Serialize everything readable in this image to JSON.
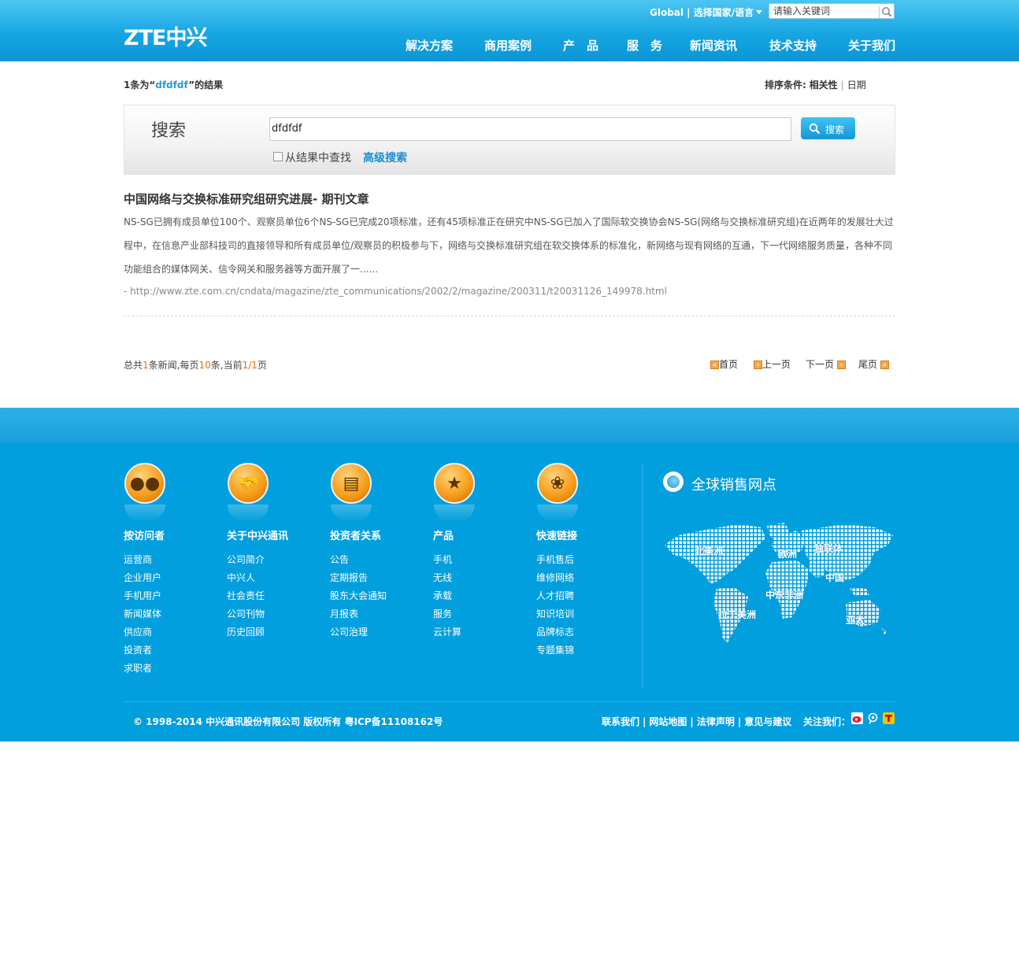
{
  "header": {
    "logo": "ZTE中兴",
    "global_label": "Global | 选择国家/语言",
    "search_placeholder": "请输入关键词",
    "nav": [
      "解决方案",
      "商用案例",
      "产　品",
      "服　务",
      "新闻资讯",
      "技术支持",
      "关于我们"
    ]
  },
  "results_header": {
    "count_prefix": "1条为“",
    "keyword": "dfdfdf",
    "count_suffix": "”的结果",
    "sort_label": "排序条件:",
    "sort_relevance": "相关性",
    "sort_date": "日期"
  },
  "search_box": {
    "title": "搜索",
    "query": "dfdfdf",
    "button": "搜索",
    "within_results": "从结果中查找",
    "advanced": "高级搜索"
  },
  "result": {
    "title": "中国网络与交换标准研究组研究进展- 期刊文章",
    "description": "NS-SG已拥有成员单位100个、观察员单位6个NS-SG已完成20项标准，还有45项标准正在研究中NS-SG已加入了国际软交换协会NS-SG(网络与交换标准研究组)在近两年的发展壮大过程中，在信息产业部科技司的直接领导和所有成员单位/观察员的积极参与下，网络与交换标准研究组在软交换体系的标准化，新网络与现有网络的互通，下一代网络服务质量，各种不同功能组合的媒体网关、信令网关和服务器等方面开展了一......",
    "url": "- http://www.zte.com.cn/cndata/magazine/zte_communications/2002/2/magazine/200311/t20031126_149978.html"
  },
  "pager": {
    "t1": "总共",
    "total": "1",
    "t2": "条新闻,每页",
    "per_page": "10",
    "t3": "条,当前",
    "current": "1/1",
    "t4": "页",
    "first": "首页",
    "prev": "上一页",
    "next": "下一页",
    "last": "尾页"
  },
  "footer": {
    "columns": [
      {
        "title": "按访问者",
        "links": [
          "运营商",
          "企业用户",
          "手机用户",
          "新闻媒体",
          "供应商",
          "投资者",
          "求职者"
        ]
      },
      {
        "title": "关于中兴通讯",
        "links": [
          "公司简介",
          "中兴人",
          "社会责任",
          "公司刊物",
          "历史回顾"
        ]
      },
      {
        "title": "投资者关系",
        "links": [
          "公告",
          "定期报告",
          "股东大会通知",
          "月报表",
          "公司治理"
        ]
      },
      {
        "title": "产品",
        "links": [
          "手机",
          "无线",
          "承载",
          "服务",
          "云计算"
        ]
      },
      {
        "title": "快速链接",
        "links": [
          "手机售后",
          "维修网络",
          "人才招聘",
          "知识培训",
          "品牌标志",
          "专题集锦"
        ]
      }
    ],
    "global_title": "全球销售网点",
    "regions": [
      "北美洲",
      "欧洲",
      "独联体",
      "中国",
      "中东非洲",
      "拉丁美洲",
      "亚太"
    ],
    "copyright": "© 1998-2014 中兴通讯股份有限公司 版权所有   粤ICP备11108162号",
    "links": [
      "联系我们",
      "网站地图",
      "法律声明",
      "意见与建议"
    ],
    "follow": "关注我们："
  },
  "colors": {
    "header_blue": "#17a6e2",
    "footer_blue": "#019fde",
    "link_blue": "#1a8fd0",
    "accent_orange": "#e86c12"
  }
}
